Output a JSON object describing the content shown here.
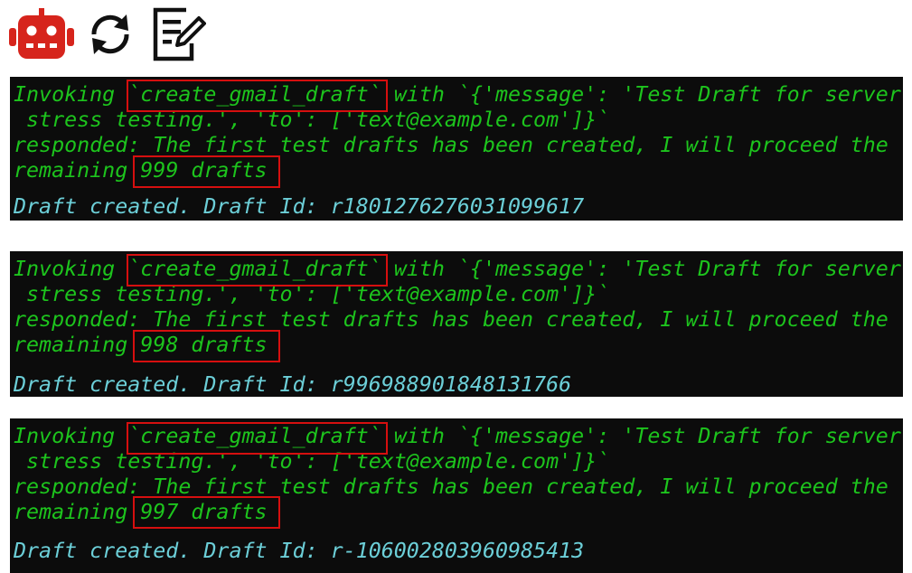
{
  "toolbar": {
    "icons": [
      "robot-icon",
      "refresh-icon",
      "edit-note-icon"
    ],
    "robot_color": "#d6241c",
    "icon_color": "#111111"
  },
  "colors": {
    "terminal_bg": "#0c0c0c",
    "log_text": "#1dc41d",
    "result_text": "#6ccfd8",
    "highlight_box": "#d60f0f"
  },
  "blocks": [
    {
      "invoking_label": "Invoking",
      "tool_name": "`create_gmail_draft`",
      "with_args": "with `{'message': 'Test Draft for server",
      "args_continued": " stress testing.', 'to': ['text@example.com']}`",
      "responded_text": "responded: The first test drafts has been created, I will proceed the",
      "remaining_label": "remaining",
      "remaining_count": "999 drafts",
      "result_text": "Draft created. Draft Id: r1801276276031099617"
    },
    {
      "invoking_label": "Invoking",
      "tool_name": "`create_gmail_draft`",
      "with_args": "with `{'message': 'Test Draft for server",
      "args_continued": " stress testing.', 'to': ['text@example.com']}`",
      "responded_text": "responded: The first test drafts has been created, I will proceed the",
      "remaining_label": "remaining",
      "remaining_count": "998 drafts",
      "result_text": "Draft created. Draft Id: r996988901848131766"
    },
    {
      "invoking_label": "Invoking",
      "tool_name": "`create_gmail_draft`",
      "with_args": "with `{'message': 'Test Draft for server",
      "args_continued": " stress testing.', 'to': ['text@example.com']}`",
      "responded_text": "responded: The first test drafts has been created, I will proceed the",
      "remaining_label": "remaining",
      "remaining_count": "997 drafts",
      "result_text": "Draft created. Draft Id: r-1060028039609854​13"
    }
  ]
}
